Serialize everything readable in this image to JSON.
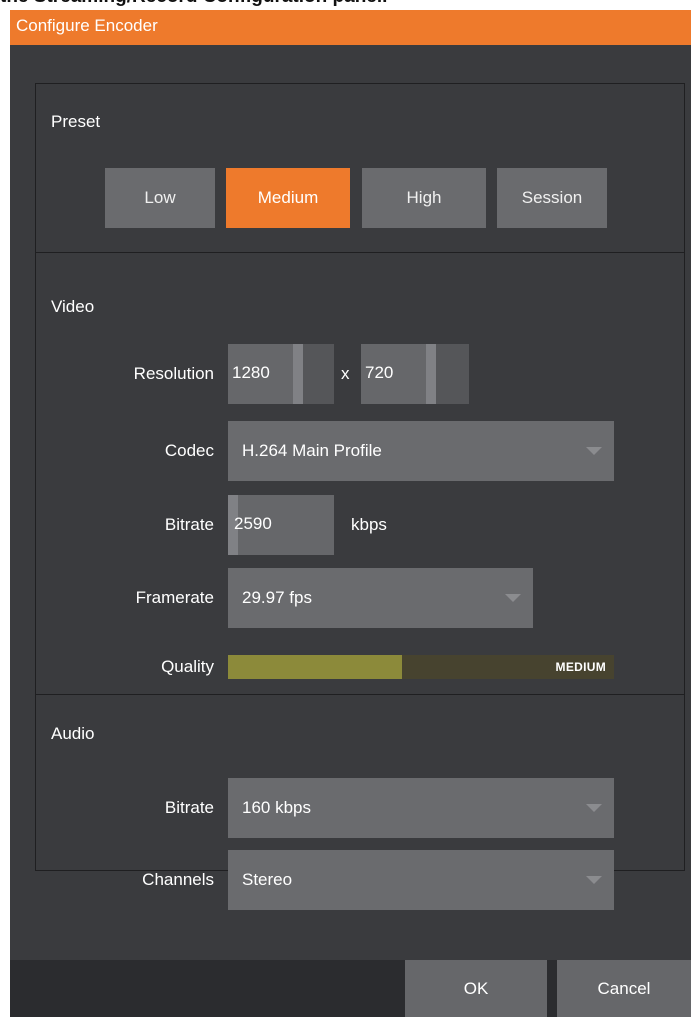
{
  "caption": "the Streaming/Record Configuration panel.",
  "dialog": {
    "title": "Configure Encoder"
  },
  "preset": {
    "label": "Preset",
    "options": [
      "Low",
      "Medium",
      "High",
      "Session"
    ],
    "selected": "Medium"
  },
  "video": {
    "label": "Video",
    "resolution": {
      "label": "Resolution",
      "width": "1280",
      "separator": "x",
      "height": "720"
    },
    "codec": {
      "label": "Codec",
      "value": "H.264  Main Profile"
    },
    "bitrate": {
      "label": "Bitrate",
      "value": "2590",
      "unit": "kbps"
    },
    "framerate": {
      "label": "Framerate",
      "value": "29.97 fps"
    },
    "quality": {
      "label": "Quality",
      "value_text": "MEDIUM",
      "level": 0.45
    }
  },
  "audio": {
    "label": "Audio",
    "bitrate": {
      "label": "Bitrate",
      "value": "160 kbps"
    },
    "channels": {
      "label": "Channels",
      "value": "Stereo"
    }
  },
  "footer": {
    "ok_label": "OK",
    "cancel_label": "Cancel"
  },
  "colors": {
    "accent": "#ee7a2c",
    "background": "#3a3b3e",
    "control": "#6a6b6e",
    "quality_fill": "#8c8a3a",
    "quality_track": "#47432f"
  }
}
